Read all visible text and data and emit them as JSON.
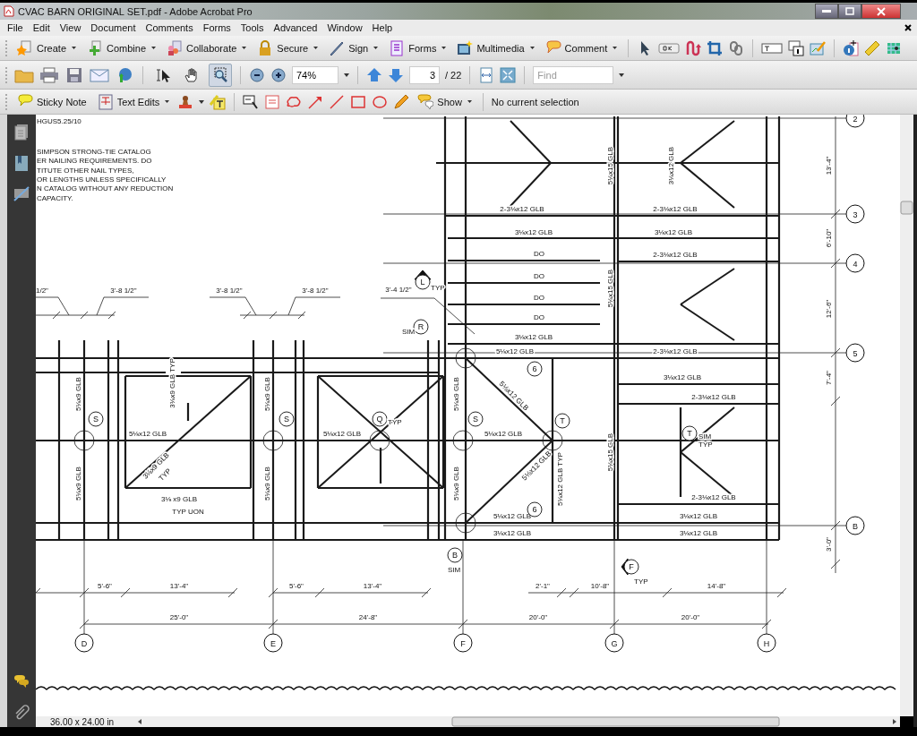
{
  "window": {
    "title": "CVAC BARN ORIGINAL SET.pdf - Adobe Acrobat Pro"
  },
  "menu": [
    "File",
    "Edit",
    "View",
    "Document",
    "Comments",
    "Forms",
    "Tools",
    "Advanced",
    "Window",
    "Help"
  ],
  "task_buttons": [
    {
      "label": "Create",
      "kind": "create"
    },
    {
      "label": "Combine",
      "kind": "combine"
    },
    {
      "label": "Collaborate",
      "kind": "collaborate"
    },
    {
      "label": "Secure",
      "kind": "secure"
    },
    {
      "label": "Sign",
      "kind": "sign"
    },
    {
      "label": "Forms",
      "kind": "forms"
    },
    {
      "label": "Multimedia",
      "kind": "multimedia"
    },
    {
      "label": "Comment",
      "kind": "comment"
    }
  ],
  "navigation": {
    "tools": [
      {
        "kind": "select",
        "selected": false
      },
      {
        "kind": "hand",
        "selected": false
      },
      {
        "kind": "zoom",
        "selected": true
      }
    ],
    "zoom": "74%",
    "page": "3",
    "page_count": "/ 22",
    "find": {
      "placeholder": "Find"
    }
  },
  "comment_toolbar": {
    "sticky_note": "Sticky Note",
    "text_edits": "Text Edits",
    "show": "Show",
    "status": "No current selection"
  },
  "drawing": {
    "notes": [
      "HGUS5.25/10",
      " SIMPSON STRONG-TIE CATALOG",
      "ER NAILING REQUIREMENTS.   DO",
      "TITUTE OTHER NAIL TYPES,",
      " OR LENGTHS UNLESS SPECIFICALLY",
      "N CATALOG WITHOUT ANY REDUCTION",
      " CAPACITY."
    ],
    "top_dimensions": [
      "1/2\"",
      "3'-8 1/2\"",
      "3'-8 1/2\"",
      "3'-8 1/2\"",
      "3'-4 1/2\""
    ],
    "callouts": [
      {
        "kind": "section",
        "label": "L",
        "notes": [
          "TYP"
        ]
      },
      {
        "kind": "detail",
        "label": "R",
        "notes": [
          "SIM"
        ]
      },
      {
        "kind": "detail",
        "label": "6"
      },
      {
        "kind": "detail",
        "label": "S"
      },
      {
        "kind": "detail",
        "label": "S"
      },
      {
        "kind": "detail",
        "label": "Q",
        "notes": [
          "TYP"
        ]
      },
      {
        "kind": "detail",
        "label": "S"
      },
      {
        "kind": "detail",
        "label": "T"
      },
      {
        "kind": "detail",
        "label": "T",
        "notes": [
          "SIM",
          "TYP"
        ]
      },
      {
        "kind": "detail",
        "label": "6"
      },
      {
        "kind": "detail",
        "label": "B",
        "notes": [
          "SIM"
        ]
      },
      {
        "kind": "section",
        "label": "F",
        "notes": [
          "TYP"
        ]
      }
    ],
    "beam_labels": [
      "5⅛x15 GLB",
      "3⅛x12 GLB",
      "2-3⅛x12 GLB",
      "2-3⅛x12 GLB",
      "3⅛x12 GLB",
      "3⅛x12 GLB",
      "DO",
      "2-3⅛x12 GLB",
      "DO",
      "DO",
      "DO",
      "5⅛x15 GLB",
      "3⅛x12 GLB",
      "5⅛x12 GLB",
      "2-3⅛x12 GLB",
      "3⅛x12 GLB",
      "2-3⅛x12 GLB",
      "5⅛x9 GLB",
      "3⅛x9 GLB TYP",
      "5⅛x9 GLB",
      "5⅛x9 GLB",
      "5⅛x12 GLB",
      "5⅛x12 GLB",
      "5⅛x12 GLB",
      "5⅛x12 GLB",
      "3⅛x9 GLB",
      "TYP",
      "5⅛x15 GLB",
      "5⅛x12 GLB",
      "5⅛x12 GLB TYP",
      "5⅛x9 GLB",
      "5⅛x9 GLB",
      "5⅛x9 GLB",
      "3⅛ x9 GLB",
      "TYP UON",
      "2-3⅛x12 GLB",
      "5⅛x12 GLB",
      "3⅛x12 GLB",
      "3⅛x12 GLB",
      "3⅛x12 GLB"
    ],
    "row_grid": [
      "2",
      "3",
      "4",
      "5",
      "B"
    ],
    "row_dimensions": [
      "13'-4\"",
      "6'-10\"",
      "12'-6\"",
      "7'-4\"",
      "3'-0\""
    ],
    "bottom_dimensions": [
      "5'-6\"",
      "13'-4\"",
      "5'-6\"",
      "13'-4\"",
      "2'-1\"",
      "10'-8\"",
      "14'-8\""
    ],
    "overall_dimensions": [
      "25'-0\"",
      "24'-8\"",
      "20'-0\"",
      "20'-0\""
    ],
    "column_grid": [
      "D",
      "E",
      "F",
      "G",
      "H"
    ]
  },
  "status_bar": {
    "page_size": "36.00 x 24.00 in"
  }
}
